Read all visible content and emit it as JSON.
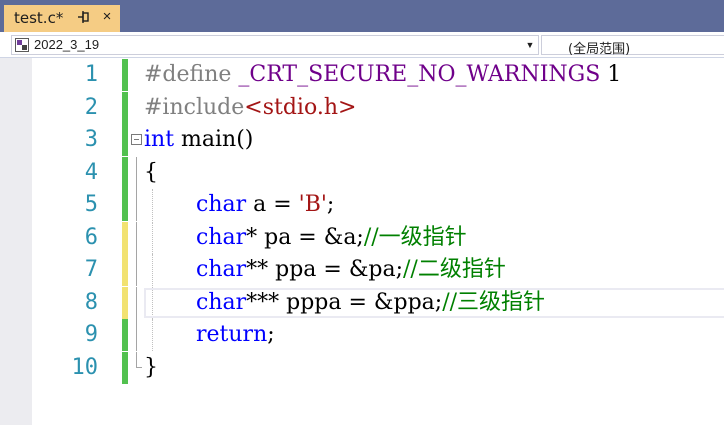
{
  "tab": {
    "title": "test.c*",
    "pin_glyph": "⊣",
    "close_glyph": "×",
    "pin_icon": "pin-icon",
    "close_icon": "close-icon",
    "background": "#f5cc84"
  },
  "navbar": {
    "scope_value": "2022_3_19",
    "scope_icon": "project-icon",
    "member_value": "(全局范围)",
    "dropdown_icon": "chevron-down-icon"
  },
  "editor": {
    "lines": [
      {
        "number": "1",
        "change": "#52c14f",
        "tokens": [
          {
            "text": "#define ",
            "kind": "pre"
          },
          {
            "text": "_CRT_SECURE_NO_WARNINGS",
            "kind": "macro"
          },
          {
            "text": " 1",
            "kind": "id"
          }
        ]
      },
      {
        "number": "2",
        "change": "#52c14f",
        "tokens": [
          {
            "text": "#include",
            "kind": "pre"
          },
          {
            "text": "<stdio.h>",
            "kind": "str"
          }
        ]
      },
      {
        "number": "3",
        "change": "#52c14f",
        "tokens": [
          {
            "text": "int",
            "kind": "kw"
          },
          {
            "text": " main()",
            "kind": "fn"
          }
        ]
      },
      {
        "number": "4",
        "change": "#52c14f",
        "tokens": [
          {
            "text": "{",
            "kind": "id"
          }
        ]
      },
      {
        "number": "5",
        "change": "#52c14f",
        "tokens": [
          {
            "text": "char",
            "kind": "kw"
          },
          {
            "text": " a = ",
            "kind": "id"
          },
          {
            "text": "'B'",
            "kind": "str"
          },
          {
            "text": ";",
            "kind": "id"
          }
        ]
      },
      {
        "number": "6",
        "change": "#f2e271",
        "tokens": [
          {
            "text": "char",
            "kind": "kw"
          },
          {
            "text": "* pa = &a;",
            "kind": "id"
          },
          {
            "text": "//一级指针",
            "kind": "cmt"
          }
        ]
      },
      {
        "number": "7",
        "change": "#f2e271",
        "tokens": [
          {
            "text": "char",
            "kind": "kw"
          },
          {
            "text": "** ppa = &pa;",
            "kind": "id"
          },
          {
            "text": "//二级指针",
            "kind": "cmt"
          }
        ]
      },
      {
        "number": "8",
        "change": "#f2e271",
        "tokens": [
          {
            "text": "char",
            "kind": "kw"
          },
          {
            "text": "*** pppa = &ppa;",
            "kind": "id"
          },
          {
            "text": "//三级指针",
            "kind": "cmt"
          }
        ]
      },
      {
        "number": "9",
        "change": "#52c14f",
        "tokens": [
          {
            "text": "return",
            "kind": "kw"
          },
          {
            "text": ";",
            "kind": "id"
          }
        ]
      },
      {
        "number": "10",
        "change": "#52c14f",
        "tokens": [
          {
            "text": "}",
            "kind": "id"
          }
        ]
      }
    ]
  }
}
